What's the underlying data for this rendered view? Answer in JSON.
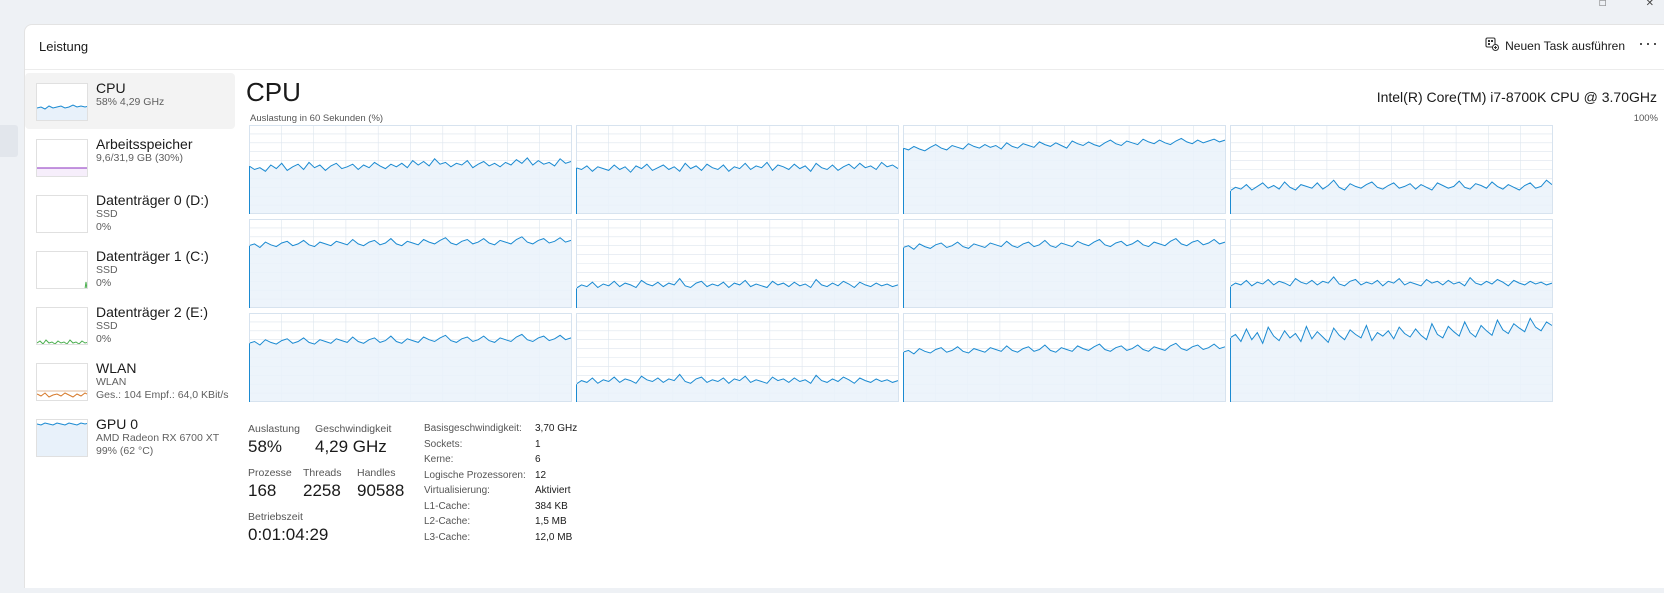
{
  "header": {
    "title": "Leistung",
    "new_task_label": "Neuen Task ausführen",
    "more_label": "···"
  },
  "sidebar": {
    "items": [
      {
        "name": "CPU",
        "sub1": "58%  4,29 GHz",
        "sub2": "",
        "sub3": "",
        "graph_color": "#1b8ad1",
        "selected": true
      },
      {
        "name": "Arbeitsspeicher",
        "sub1": "9,6/31,9 GB (30%)",
        "sub2": "",
        "sub3": "",
        "graph_color": "#8b2fbf",
        "selected": false
      },
      {
        "name": "Datenträger 0 (D:)",
        "sub1": "SSD",
        "sub2": "0%",
        "sub3": "",
        "graph_color": "#4caf50",
        "selected": false
      },
      {
        "name": "Datenträger 1 (C:)",
        "sub1": "SSD",
        "sub2": "0%",
        "sub3": "",
        "graph_color": "#4caf50",
        "selected": false
      },
      {
        "name": "Datenträger 2 (E:)",
        "sub1": "SSD",
        "sub2": "0%",
        "sub3": "",
        "graph_color": "#4caf50",
        "selected": false
      },
      {
        "name": "WLAN",
        "sub1": "WLAN",
        "sub2": "Ges.: 104 Empf.: 64,0 KBit/s",
        "sub3": "",
        "graph_color": "#d77a2b",
        "selected": false
      },
      {
        "name": "GPU 0",
        "sub1": "AMD Radeon RX 6700 XT",
        "sub2": "99% (62 °C)",
        "sub3": "",
        "graph_color": "#1b8ad1",
        "selected": false
      }
    ]
  },
  "main": {
    "title": "CPU",
    "model": "Intel(R) Core(TM) i7-8700K CPU @ 3.70GHz",
    "axis_label": "Auslastung in 60 Sekunden (%)",
    "axis_max": "100%",
    "graph_color": "#1b8ad1",
    "graph_fill": "#eaf2fa"
  },
  "chart_data": {
    "type": "line",
    "title": "Auslastung in 60 Sekunden (%)",
    "ylim": [
      0,
      100
    ],
    "series": [
      {
        "values": [
          54,
          50,
          52,
          48,
          55,
          51,
          57,
          49,
          53,
          56,
          50,
          58,
          52,
          55,
          49,
          54,
          57,
          51,
          53,
          56,
          50,
          55,
          52,
          58,
          54,
          51,
          56,
          53,
          57,
          52,
          60,
          55,
          59,
          54,
          62,
          56,
          58,
          53,
          57,
          55,
          60,
          52,
          56,
          59,
          54,
          57,
          53,
          58,
          55,
          61,
          57,
          63,
          55,
          60,
          56,
          58,
          54,
          62,
          57,
          59
        ]
      },
      {
        "values": [
          52,
          50,
          54,
          48,
          53,
          51,
          49,
          55,
          50,
          53,
          47,
          54,
          51,
          56,
          49,
          52,
          55,
          50,
          53,
          48,
          57,
          51,
          54,
          49,
          56,
          52,
          50,
          55,
          48,
          53,
          51,
          57,
          50,
          54,
          52,
          58,
          49,
          55,
          53,
          50,
          56,
          51,
          54,
          48,
          57,
          52,
          50,
          55,
          49,
          53,
          56,
          51,
          57,
          52,
          54,
          50,
          58,
          53,
          55,
          51
        ]
      },
      {
        "values": [
          74,
          72,
          76,
          73,
          71,
          75,
          78,
          74,
          72,
          77,
          75,
          73,
          79,
          76,
          74,
          78,
          75,
          77,
          73,
          80,
          76,
          74,
          79,
          77,
          75,
          81,
          78,
          76,
          80,
          77,
          74,
          82,
          79,
          77,
          81,
          78,
          76,
          80,
          83,
          79,
          77,
          82,
          80,
          78,
          84,
          81,
          79,
          83,
          80,
          78,
          82,
          85,
          81,
          79,
          83,
          80,
          82,
          84,
          81,
          83
        ]
      },
      {
        "values": [
          26,
          30,
          28,
          33,
          27,
          31,
          35,
          29,
          32,
          28,
          36,
          30,
          27,
          33,
          31,
          29,
          35,
          28,
          32,
          38,
          30,
          27,
          34,
          31,
          29,
          33,
          36,
          30,
          28,
          32,
          35,
          29,
          31,
          34,
          28,
          33,
          30,
          27,
          35,
          32,
          29,
          31,
          37,
          30,
          28,
          34,
          32,
          29,
          36,
          31,
          28,
          33,
          30,
          27,
          32,
          35,
          29,
          31,
          38,
          33
        ]
      },
      {
        "values": [
          70,
          72,
          68,
          74,
          71,
          69,
          73,
          75,
          70,
          72,
          76,
          71,
          69,
          74,
          72,
          70,
          75,
          73,
          71,
          77,
          72,
          70,
          74,
          76,
          71,
          73,
          78,
          72,
          70,
          75,
          73,
          71,
          77,
          74,
          72,
          76,
          79,
          73,
          71,
          75,
          77,
          72,
          74,
          78,
          73,
          71,
          76,
          74,
          72,
          77,
          80,
          74,
          72,
          76,
          78,
          73,
          75,
          79,
          74,
          76
        ]
      },
      {
        "values": [
          22,
          26,
          24,
          29,
          23,
          27,
          25,
          30,
          24,
          28,
          26,
          23,
          31,
          27,
          25,
          29,
          24,
          28,
          26,
          33,
          25,
          23,
          28,
          30,
          24,
          27,
          25,
          29,
          23,
          28,
          26,
          31,
          24,
          27,
          25,
          23,
          30,
          26,
          28,
          24,
          29,
          25,
          27,
          23,
          32,
          26,
          24,
          28,
          25,
          30,
          27,
          23,
          29,
          26,
          24,
          28,
          25,
          27,
          24,
          26
        ]
      },
      {
        "values": [
          68,
          70,
          66,
          72,
          69,
          67,
          71,
          73,
          68,
          70,
          74,
          69,
          67,
          72,
          70,
          68,
          73,
          71,
          69,
          75,
          70,
          68,
          72,
          74,
          69,
          71,
          76,
          70,
          68,
          73,
          71,
          69,
          75,
          72,
          70,
          74,
          77,
          71,
          69,
          73,
          75,
          70,
          72,
          76,
          71,
          69,
          74,
          72,
          70,
          75,
          78,
          72,
          70,
          74,
          76,
          71,
          73,
          77,
          72,
          74
        ]
      },
      {
        "values": [
          24,
          28,
          26,
          31,
          25,
          29,
          27,
          32,
          26,
          30,
          28,
          25,
          33,
          29,
          27,
          31,
          26,
          30,
          28,
          35,
          27,
          25,
          30,
          32,
          26,
          29,
          27,
          31,
          25,
          30,
          28,
          33,
          26,
          29,
          27,
          25,
          32,
          28,
          30,
          26,
          31,
          27,
          29,
          25,
          34,
          28,
          26,
          30,
          27,
          32,
          29,
          25,
          31,
          28,
          26,
          30,
          27,
          29,
          26,
          28
        ]
      },
      {
        "values": [
          66,
          68,
          64,
          70,
          67,
          65,
          69,
          71,
          66,
          68,
          72,
          67,
          65,
          70,
          68,
          66,
          71,
          69,
          67,
          73,
          68,
          66,
          70,
          72,
          67,
          69,
          74,
          68,
          66,
          71,
          69,
          67,
          73,
          70,
          68,
          72,
          75,
          69,
          67,
          71,
          73,
          68,
          70,
          74,
          69,
          67,
          72,
          70,
          68,
          73,
          76,
          70,
          68,
          72,
          74,
          69,
          71,
          75,
          70,
          72
        ]
      },
      {
        "values": [
          20,
          24,
          22,
          27,
          21,
          25,
          23,
          28,
          22,
          26,
          24,
          21,
          29,
          25,
          23,
          27,
          22,
          26,
          24,
          31,
          23,
          21,
          26,
          28,
          22,
          25,
          23,
          27,
          21,
          26,
          24,
          29,
          22,
          25,
          23,
          21,
          28,
          24,
          26,
          22,
          27,
          23,
          25,
          21,
          30,
          24,
          22,
          26,
          23,
          28,
          25,
          21,
          27,
          24,
          22,
          26,
          23,
          25,
          22,
          24
        ]
      },
      {
        "values": [
          56,
          58,
          54,
          60,
          57,
          55,
          59,
          61,
          56,
          58,
          62,
          57,
          55,
          60,
          58,
          56,
          61,
          59,
          57,
          63,
          58,
          56,
          60,
          62,
          57,
          59,
          64,
          58,
          56,
          61,
          59,
          57,
          63,
          60,
          58,
          62,
          65,
          59,
          57,
          61,
          63,
          58,
          60,
          64,
          59,
          57,
          62,
          60,
          58,
          63,
          66,
          60,
          58,
          62,
          64,
          59,
          61,
          65,
          60,
          62
        ]
      },
      {
        "values": [
          72,
          76,
          68,
          82,
          70,
          78,
          66,
          84,
          74,
          69,
          80,
          72,
          77,
          68,
          85,
          71,
          79,
          73,
          67,
          83,
          75,
          70,
          81,
          76,
          72,
          86,
          69,
          78,
          74,
          80,
          71,
          84,
          77,
          73,
          82,
          75,
          70,
          88,
          76,
          72,
          85,
          79,
          74,
          90,
          78,
          73,
          86,
          80,
          75,
          92,
          81,
          77,
          88,
          83,
          79,
          94,
          84,
          80,
          90,
          86
        ]
      }
    ]
  },
  "stats": {
    "util_label": "Auslastung",
    "util_value": "58%",
    "speed_label": "Geschwindigkeit",
    "speed_value": "4,29 GHz",
    "proc_label": "Prozesse",
    "proc_value": "168",
    "threads_label": "Threads",
    "threads_value": "2258",
    "handles_label": "Handles",
    "handles_value": "90588",
    "uptime_label": "Betriebszeit",
    "uptime_value": "0:01:04:29"
  },
  "specs": [
    {
      "key": "Basisgeschwindigkeit:",
      "value": "3,70 GHz"
    },
    {
      "key": "Sockets:",
      "value": "1"
    },
    {
      "key": "Kerne:",
      "value": "6"
    },
    {
      "key": "Logische Prozessoren:",
      "value": "12"
    },
    {
      "key": "Virtualisierung:",
      "value": "Aktiviert"
    },
    {
      "key": "L1-Cache:",
      "value": "384 KB"
    },
    {
      "key": "L2-Cache:",
      "value": "1,5 MB"
    },
    {
      "key": "L3-Cache:",
      "value": "12,0 MB"
    }
  ]
}
